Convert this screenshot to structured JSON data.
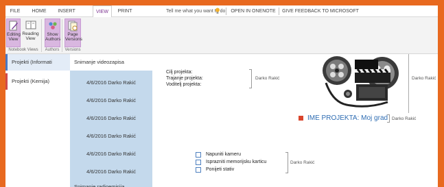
{
  "ribbon_tabs": [
    "FILE",
    "HOME",
    "INSERT",
    "VIEW",
    "PRINT"
  ],
  "tell_me_placeholder": "Tell me what you want to do",
  "extra_tabs": [
    "OPEN IN ONENOTE",
    "GIVE FEEDBACK TO MICROSOFT"
  ],
  "ribbon": {
    "editing_view": "Editing View",
    "reading_view": "Reading View",
    "show_authors": "Show Authors",
    "page_versions": "Page Versions",
    "group_notebook_views": "Notebook Views",
    "group_authors": "Authors",
    "group_versions": "Versions"
  },
  "sections": [
    "Projekti (Informati",
    "Projekti (Kemija)"
  ],
  "section_colors": [
    "#4a78c2",
    "#d14a4a"
  ],
  "pages": [
    {
      "label": "Snimanje videozapisa",
      "type": "top",
      "active": true
    },
    {
      "label": "4/6/2016 Darko Rakić",
      "type": "sub",
      "active": false
    },
    {
      "label": "4/6/2016 Darko Rakić",
      "type": "sub",
      "active": false
    },
    {
      "label": "4/6/2016 Darko Rakić",
      "type": "sub",
      "active": false
    },
    {
      "label": "4/6/2016 Darko Rakić",
      "type": "sub",
      "active": false
    },
    {
      "label": "4/6/2016 Darko Rakić",
      "type": "sub",
      "active": false
    },
    {
      "label": "4/6/2016 Darko Rakić",
      "type": "sub",
      "active": false
    },
    {
      "label": "Snimanje radioemisija",
      "type": "top",
      "active": false
    }
  ],
  "canvas": {
    "info_lines": [
      "Cilj projekta:",
      "Trajanje projekta:",
      "Voditelj projekta:"
    ],
    "author": "Darko Rakić",
    "project_title": "IME PROJEKTA: Moj grad",
    "todos": [
      "Napuniti kameru",
      "Isprazniti memorijsku karticu",
      "Ponijeti stativ"
    ]
  }
}
